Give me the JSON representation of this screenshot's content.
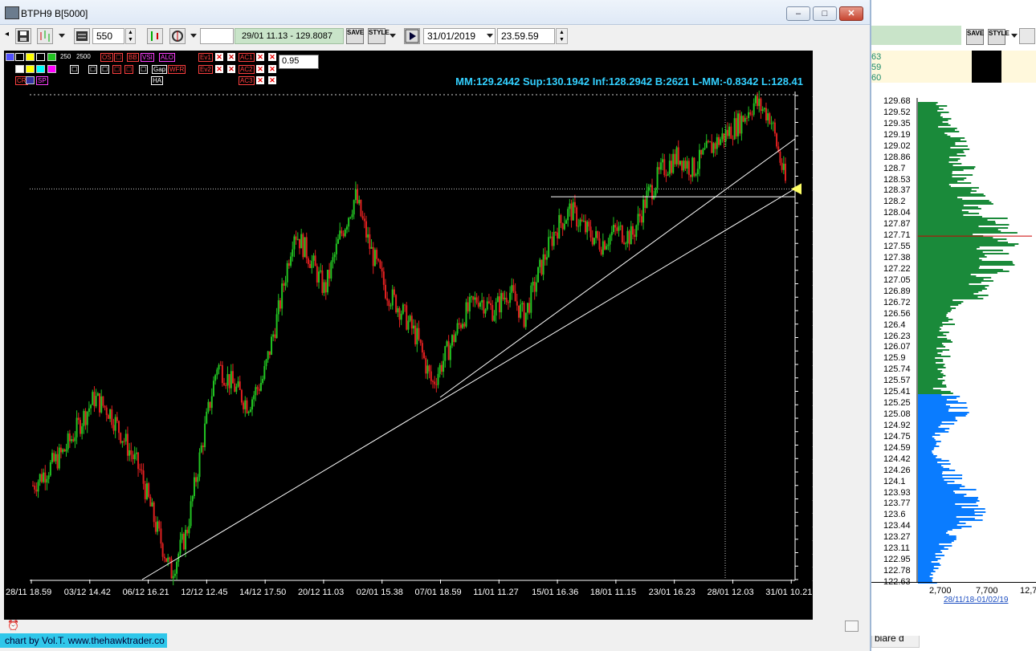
{
  "window": {
    "title": "BTPH9 B[5000]",
    "buttons": {
      "minimize": "–",
      "maximize": "□",
      "close": "✕"
    }
  },
  "toolbar": {
    "bars": "550",
    "range_text": "29/01 11.13 - 129.8087",
    "date": "31/01/2019",
    "time": "23.59.59",
    "save_label": "SAVE",
    "style_label": "STYLE"
  },
  "chart": {
    "settings": {
      "ticks_a": "250",
      "ticks_b": "2500",
      "factor": "0.95"
    },
    "labels": {
      "cr": "CR",
      "sp": "SP",
      "os": "OS",
      "bb": "BB",
      "vsi": "VSI",
      "alo": "ALO",
      "ha": "HA",
      "gap": "Gap",
      "wfr": "WFR",
      "ev1": "Ev1",
      "ev2": "Ev2",
      "ac1": "AC1",
      "ac2": "AC2",
      "ac3": "AC3"
    },
    "stats": "MM:129.2442 Sup:130.1942 Inf:128.2942 B:2621 L-MM:-0.8342 L:128.41",
    "colors": {
      "up": "#22c422",
      "down": "#e02020",
      "bg": "#000000",
      "line": "#ffffff",
      "accent": "#33d0ff"
    }
  },
  "chart_data": {
    "type": "candlestick",
    "x_ticks": [
      "28/11 18.59",
      "03/12 14.42",
      "06/12 16.21",
      "12/12 12.45",
      "14/12 17.50",
      "20/12 11.03",
      "02/01 15.38",
      "07/01 18.59",
      "11/01 11.27",
      "15/01 16.36",
      "18/01 11.15",
      "23/01 16.23",
      "28/01 12.03",
      "31/01 10.21"
    ],
    "y_ticks": [
      "129.8",
      "129.6",
      "129.4",
      "129.2",
      "129",
      "128.8",
      "128.6",
      "128.4",
      "128.2",
      "128",
      "127.8",
      "127.6",
      "127.4",
      "127.2",
      "127",
      "126.8",
      "126.6",
      "126.4",
      "126.2",
      "126",
      "125.8",
      "125.6",
      "125.4",
      "125.2",
      "125",
      "124.8",
      "124.6",
      "124.4",
      "124.2",
      "124",
      "123.8",
      "123.6",
      "123.4",
      "123.2",
      "123",
      "122.8",
      "122.6"
    ],
    "ylim": [
      122.6,
      129.8
    ],
    "path": [
      [
        0,
        124.0
      ],
      [
        2,
        124.5
      ],
      [
        4,
        125.3
      ],
      [
        5,
        125.1
      ],
      [
        7,
        124.2
      ],
      [
        8,
        123.4
      ],
      [
        9,
        122.7
      ],
      [
        10,
        123.3
      ],
      [
        11,
        124.6
      ],
      [
        12,
        125.8
      ],
      [
        13,
        125.5
      ],
      [
        14,
        125.2
      ],
      [
        15,
        125.6
      ],
      [
        16,
        126.6
      ],
      [
        17,
        127.8
      ],
      [
        18,
        127.4
      ],
      [
        19,
        126.9
      ],
      [
        20,
        127.7
      ],
      [
        21,
        128.3
      ],
      [
        22,
        127.5
      ],
      [
        23,
        126.9
      ],
      [
        24,
        126.6
      ],
      [
        25,
        126.2
      ],
      [
        26,
        125.5
      ],
      [
        27,
        126.0
      ],
      [
        28,
        126.5
      ],
      [
        29,
        126.8
      ],
      [
        30,
        126.6
      ],
      [
        31,
        126.9
      ],
      [
        32,
        126.5
      ],
      [
        33,
        127.2
      ],
      [
        34,
        127.8
      ],
      [
        35,
        128.1
      ],
      [
        36,
        127.8
      ],
      [
        37,
        127.6
      ],
      [
        38,
        127.8
      ],
      [
        39,
        127.7
      ],
      [
        40,
        128.3
      ],
      [
        41,
        128.7
      ],
      [
        42,
        128.9
      ],
      [
        43,
        128.7
      ],
      [
        44,
        129.0
      ],
      [
        45,
        129.2
      ],
      [
        46,
        129.4
      ],
      [
        47,
        129.7
      ],
      [
        48,
        129.5
      ],
      [
        49,
        128.5
      ]
    ],
    "reference_level": 128.41,
    "support_level": 128.2942
  },
  "volume_profile": {
    "price_labels": [
      "129.68",
      "129.52",
      "129.35",
      "129.19",
      "129.02",
      "128.86",
      "128.7",
      "128.53",
      "128.37",
      "128.2",
      "128.04",
      "127.87",
      "127.71",
      "127.55",
      "127.38",
      "127.22",
      "127.05",
      "126.89",
      "126.72",
      "126.56",
      "126.4",
      "126.23",
      "126.07",
      "125.9",
      "125.74",
      "125.57",
      "125.41",
      "125.25",
      "125.08",
      "124.92",
      "124.75",
      "124.59",
      "124.42",
      "124.26",
      "124.1",
      "123.93",
      "123.77",
      "123.6",
      "123.44",
      "123.27",
      "123.11",
      "122.95",
      "122.78",
      "122.63"
    ],
    "x_axis": [
      "2,700",
      "7,700",
      "12,7"
    ],
    "date_range": "28/11/18-01/02/19",
    "colors": {
      "upper": "#1a8a3a",
      "lower": "#0a7cff",
      "poc": "#cc0000"
    }
  },
  "right_panel": {
    "values": [
      "63",
      "59",
      "60"
    ],
    "bottom_text": "biare d",
    "save_label": "SAVE",
    "style_label": "STYLE"
  },
  "footer": {
    "credit": "chart by Vol.T. www.thehawktrader.co"
  }
}
